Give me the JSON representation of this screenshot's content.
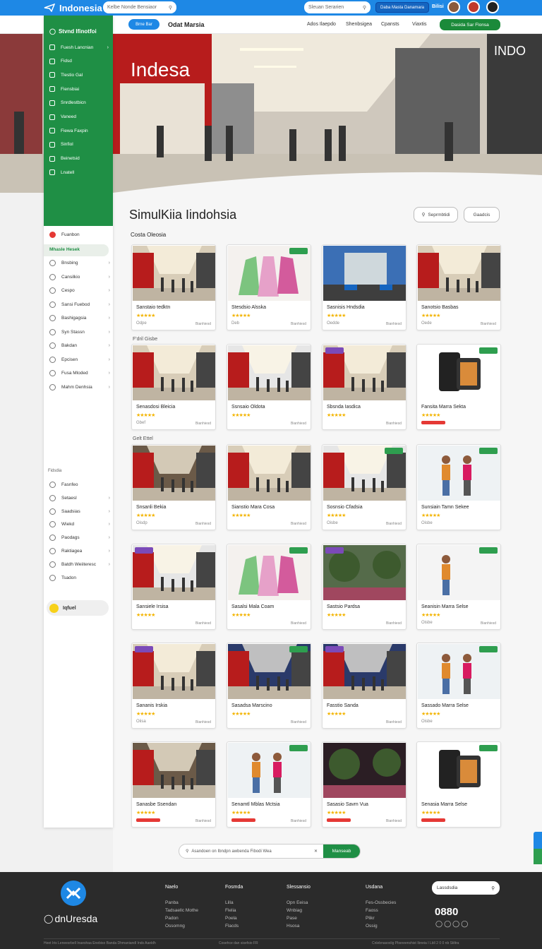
{
  "topbar": {
    "brand": "Indonesia",
    "search1_placeholder": "Kelbe Nonde Bensiaor",
    "search2_placeholder": "Sleuan Serarien",
    "button": "Daba Masta Danamara",
    "lang": "Bilisi"
  },
  "navbar": {
    "pill": "Brne Bar",
    "title": "Odat Marsia",
    "links": [
      "Ados Ilaepdo",
      "Shenbsigea",
      "Cpansts",
      "Viaxtis"
    ],
    "cta": "Dasida Sar Flonsa"
  },
  "sidebar": {
    "header": "Stvnd Ifinotfoi",
    "green_items": [
      {
        "label": "Fuesh Lancnian",
        "chev": true
      },
      {
        "label": "Fidsd",
        "chev": false
      },
      {
        "label": "Tlestio Gal",
        "chev": false
      },
      {
        "label": "Fiensbiai",
        "chev": false
      },
      {
        "label": "Snrdlestbicn",
        "chev": false
      },
      {
        "label": "Vaneed",
        "chev": false
      },
      {
        "label": "Fiewa Faxpin",
        "chev": false
      },
      {
        "label": "Sinfiol",
        "chev": false
      },
      {
        "label": "Beinetsid",
        "chev": false
      },
      {
        "label": "Lnatell",
        "chev": false
      }
    ],
    "section1": "Fuanbon",
    "selected": "Mhasle Hesek",
    "items": [
      {
        "label": "Bnsbing",
        "chev": true
      },
      {
        "label": "Cansilkio",
        "chev": true
      },
      {
        "label": "Cespo",
        "chev": true
      },
      {
        "label": "Sansi Fuebod",
        "chev": true
      },
      {
        "label": "Bashigagsia",
        "chev": true
      },
      {
        "label": "Syn Stassn",
        "chev": true
      },
      {
        "label": "Bakdan",
        "chev": true
      },
      {
        "label": "Epcisen",
        "chev": true
      },
      {
        "label": "Fusa Mloded",
        "chev": true
      },
      {
        "label": "Mahm Denhsia",
        "chev": true
      }
    ],
    "section2": "Fidsdia",
    "items2": [
      {
        "label": "Fasnfeo",
        "chev": false
      },
      {
        "label": "Setaesl",
        "chev": true
      },
      {
        "label": "Saadsias",
        "chev": true
      },
      {
        "label": "Wiekd",
        "chev": true
      },
      {
        "label": "Paodags",
        "chev": true
      },
      {
        "label": "Raktiagea",
        "chev": true
      },
      {
        "label": "Batdh Weiiteresc",
        "chev": true
      },
      {
        "label": "Tsadon",
        "chev": false
      }
    ],
    "badge": "Iqfuel"
  },
  "main": {
    "title": "SimulKiia Iindohsia",
    "filter1": "Seprmbtidi",
    "filter2": "Gaadcis",
    "sections": [
      "Costa Oleosia",
      "F'dril Gisbe",
      "Gelt Ettel"
    ],
    "cards": [
      {
        "title": "Sanstaio tedktn",
        "meta": "Odpe",
        "foot": "Bianhiesd",
        "scene": "mall",
        "tag": "",
        "red": false
      },
      {
        "title": "Stesdsio Alsska",
        "meta": "Deb",
        "foot": "Bianhiesd",
        "scene": "clothes",
        "tag": "g",
        "red": false
      },
      {
        "title": "Sasnisis Hndsdia",
        "meta": "Oedde",
        "foot": "Bianhiesd",
        "scene": "building",
        "tag": "",
        "red": false
      },
      {
        "title": "Sanotsio Basbas",
        "meta": "Oede",
        "foot": "Bianhiesd",
        "scene": "mall",
        "tag": "",
        "red": false
      },
      {
        "title": "Senasdosi Bleicia",
        "meta": "Gbef",
        "foot": "Bianhiesd",
        "scene": "mall",
        "tag": "",
        "red": false
      },
      {
        "title": "Ssnsaio Oldota",
        "meta": "",
        "foot": "Bianhiesd",
        "scene": "mall-white",
        "tag": "",
        "red": false
      },
      {
        "title": "Sbsnda Iasdica",
        "meta": "",
        "foot": "Bianhiesd",
        "scene": "mall",
        "tag": "l",
        "red": false
      },
      {
        "title": "Fansita Marra Sekta",
        "meta": "",
        "foot": "",
        "scene": "phone",
        "tag": "g",
        "red": true
      },
      {
        "title": "Snsanli Bekia",
        "meta": "Oisdp",
        "foot": "Bianhiesd",
        "scene": "mall-dark",
        "tag": "",
        "red": false
      },
      {
        "title": "Sianstio Mara Cosa",
        "meta": "",
        "foot": "Bianhiesd",
        "scene": "mall",
        "tag": "",
        "red": false
      },
      {
        "title": "Sosnsio Cfadsia",
        "meta": "Oisbe",
        "foot": "Bianhiesd",
        "scene": "mall-white",
        "tag": "g",
        "red": false
      },
      {
        "title": "Sunsiain Tamn Sekee",
        "meta": "Oisbe",
        "foot": "",
        "scene": "people",
        "tag": "g",
        "red": false
      },
      {
        "title": "Sansiele Irsisa",
        "meta": "",
        "foot": "Bianhiesd",
        "scene": "mall-white",
        "tag": "l",
        "red": false
      },
      {
        "title": "Sasalsi Mala Coam",
        "meta": "",
        "foot": "Bianhiesd",
        "scene": "clothes",
        "tag": "g",
        "red": false
      },
      {
        "title": "Sastsio Pardsa",
        "meta": "",
        "foot": "Bianhiesd",
        "scene": "garden",
        "tag": "l",
        "red": false
      },
      {
        "title": "Seanisin Marra Selse",
        "meta": "Oisbe",
        "foot": "Bianhiesd",
        "scene": "person",
        "tag": "g",
        "red": false
      },
      {
        "title": "Sananis Irskia",
        "meta": "Oiisa",
        "foot": "Bianhiesd",
        "scene": "mall",
        "tag": "l",
        "red": false
      },
      {
        "title": "Sasadsa Marscino",
        "meta": "",
        "foot": "Bianhiesd",
        "scene": "store",
        "tag": "g",
        "red": false
      },
      {
        "title": "Fasstio Sanda",
        "meta": "",
        "foot": "Bianhiesd",
        "scene": "store",
        "tag": "l",
        "red": false
      },
      {
        "title": "Sassado Marra Selse",
        "meta": "Oisbe",
        "foot": "",
        "scene": "people",
        "tag": "g",
        "red": false
      },
      {
        "title": "Sanasbe Ssendan",
        "meta": "",
        "foot": "Bianhiesd",
        "scene": "mall-dark",
        "tag": "",
        "red": true
      },
      {
        "title": "Senamtl Mblas Mctsia",
        "meta": "",
        "foot": "Bianhiesd",
        "scene": "people",
        "tag": "g",
        "red": true
      },
      {
        "title": "Sasasio Savm Vua",
        "meta": "",
        "foot": "Bianhiesd",
        "scene": "garden-night",
        "tag": "",
        "red": true
      },
      {
        "title": "Senasia Marra Selse",
        "meta": "",
        "foot": "",
        "scene": "phone",
        "tag": "g",
        "red": true
      }
    ],
    "stars": "★★★★★"
  },
  "bottom_search": {
    "placeholder": "Asandoen on Ibndpn awbenda Fibodi Wea",
    "button": "Manseab"
  },
  "footer": {
    "logo_text": "dnUresda",
    "col_titles": [
      "Naelo",
      "Fosmda",
      "Slessansio",
      "Usdana"
    ],
    "col1": [
      "Panba",
      "Tadsaellc Mothe",
      "Padon",
      "Ossomng"
    ],
    "col2": [
      "Lilla",
      "Flelia",
      "Poela",
      "Flacds"
    ],
    "col3": [
      "Opn Eeisa",
      "Wnbiag",
      "Pase",
      "Hsosa"
    ],
    "col4": [
      "Fes-Ossbecies",
      "Faoss",
      "Plikr",
      "Ossig"
    ],
    "search": "Lassdsdia",
    "number": "0880",
    "copy_left": "Heet Iris Leneesrbell Inaeshaa Enebiso Banda Dhmaniandl Inds Aaeldh",
    "copy_mid": "Cosehce dan sisefsio FR",
    "copy_right": "Cnlebnasoxlig Pbsneenshist Ibneia I Lbll 2 0 0 nb Stiltra"
  }
}
